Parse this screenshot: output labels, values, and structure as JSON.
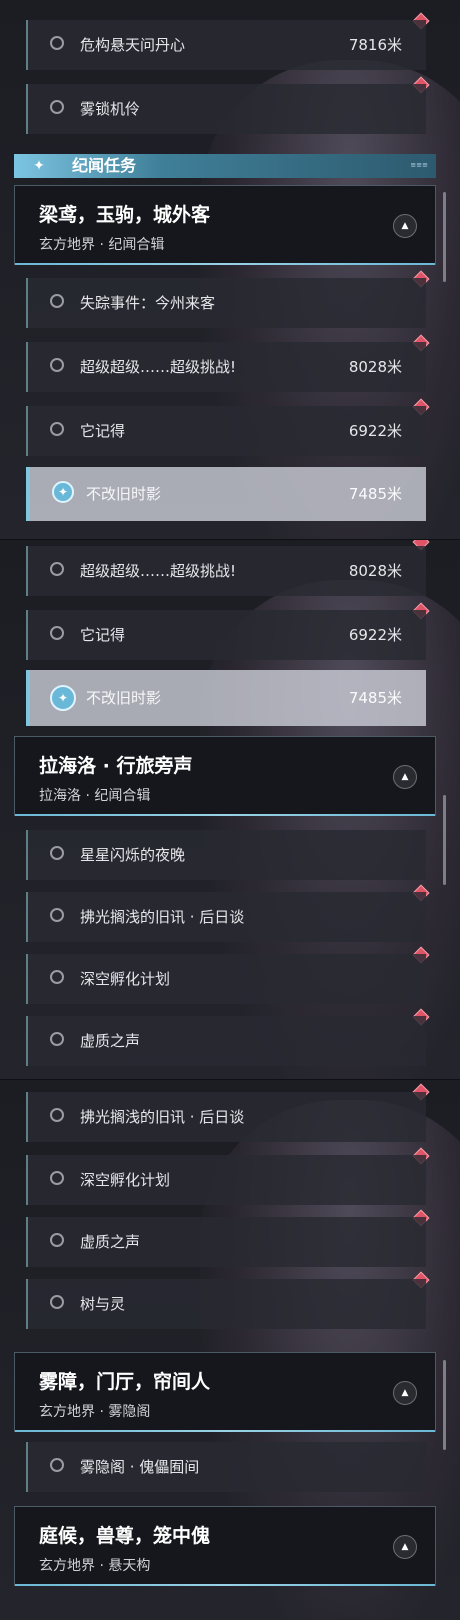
{
  "panel1": {
    "top_rows": [
      {
        "label": "危构悬天问丹心",
        "distance": "7816米"
      },
      {
        "label": "雾锁机伶",
        "distance": ""
      }
    ],
    "section_title": "纪闻任务",
    "group": {
      "title": "梁鸢，玉驹，城外客",
      "subtitle": "玄方地界 · 纪闻合辑"
    },
    "rows": [
      {
        "label": "失踪事件：今州来客",
        "distance": ""
      },
      {
        "label": "超级超级……超级挑战!",
        "distance": "8028米"
      },
      {
        "label": "它记得",
        "distance": "6922米"
      },
      {
        "label": "不改旧时影",
        "distance": "7485米",
        "active": true
      }
    ]
  },
  "panel2": {
    "top_rows": [
      {
        "label": "超级超级……超级挑战!",
        "distance": "8028米"
      },
      {
        "label": "它记得",
        "distance": "6922米"
      },
      {
        "label": "不改旧时影",
        "distance": "7485米",
        "active": true
      }
    ],
    "group": {
      "title": "拉海洛 · 行旅旁声",
      "subtitle": "拉海洛 · 纪闻合辑"
    },
    "rows": [
      {
        "label": "星星闪烁的夜晚",
        "distance": ""
      },
      {
        "label": "拂光搁浅的旧讯 · 后日谈",
        "distance": ""
      },
      {
        "label": "深空孵化计划",
        "distance": ""
      },
      {
        "label": "虚质之声",
        "distance": ""
      }
    ]
  },
  "panel3": {
    "top_rows": [
      {
        "label": "拂光搁浅的旧讯 · 后日谈",
        "distance": ""
      },
      {
        "label": "深空孵化计划",
        "distance": ""
      },
      {
        "label": "虚质之声",
        "distance": ""
      },
      {
        "label": "树与灵",
        "distance": ""
      }
    ],
    "group_a": {
      "title": "雾障，门厅，帘间人",
      "subtitle": "玄方地界 · 雾隐阁"
    },
    "row_a": {
      "label": "雾隐阁 · 傀儡囿间",
      "distance": ""
    },
    "group_b": {
      "title": "庭候，兽尊，笼中傀",
      "subtitle": "玄方地界 · 悬天构"
    }
  },
  "icons": {
    "radio": "radio-circle-icon",
    "nav": "navigation-target-icon",
    "collapse": "chevron-up-icon",
    "tracked": "red-diamond-marker-icon",
    "section": "four-point-star-icon"
  },
  "colors": {
    "accent": "#7fc6e0",
    "marker": "#e05468",
    "active_row": "#c8cbd4"
  }
}
